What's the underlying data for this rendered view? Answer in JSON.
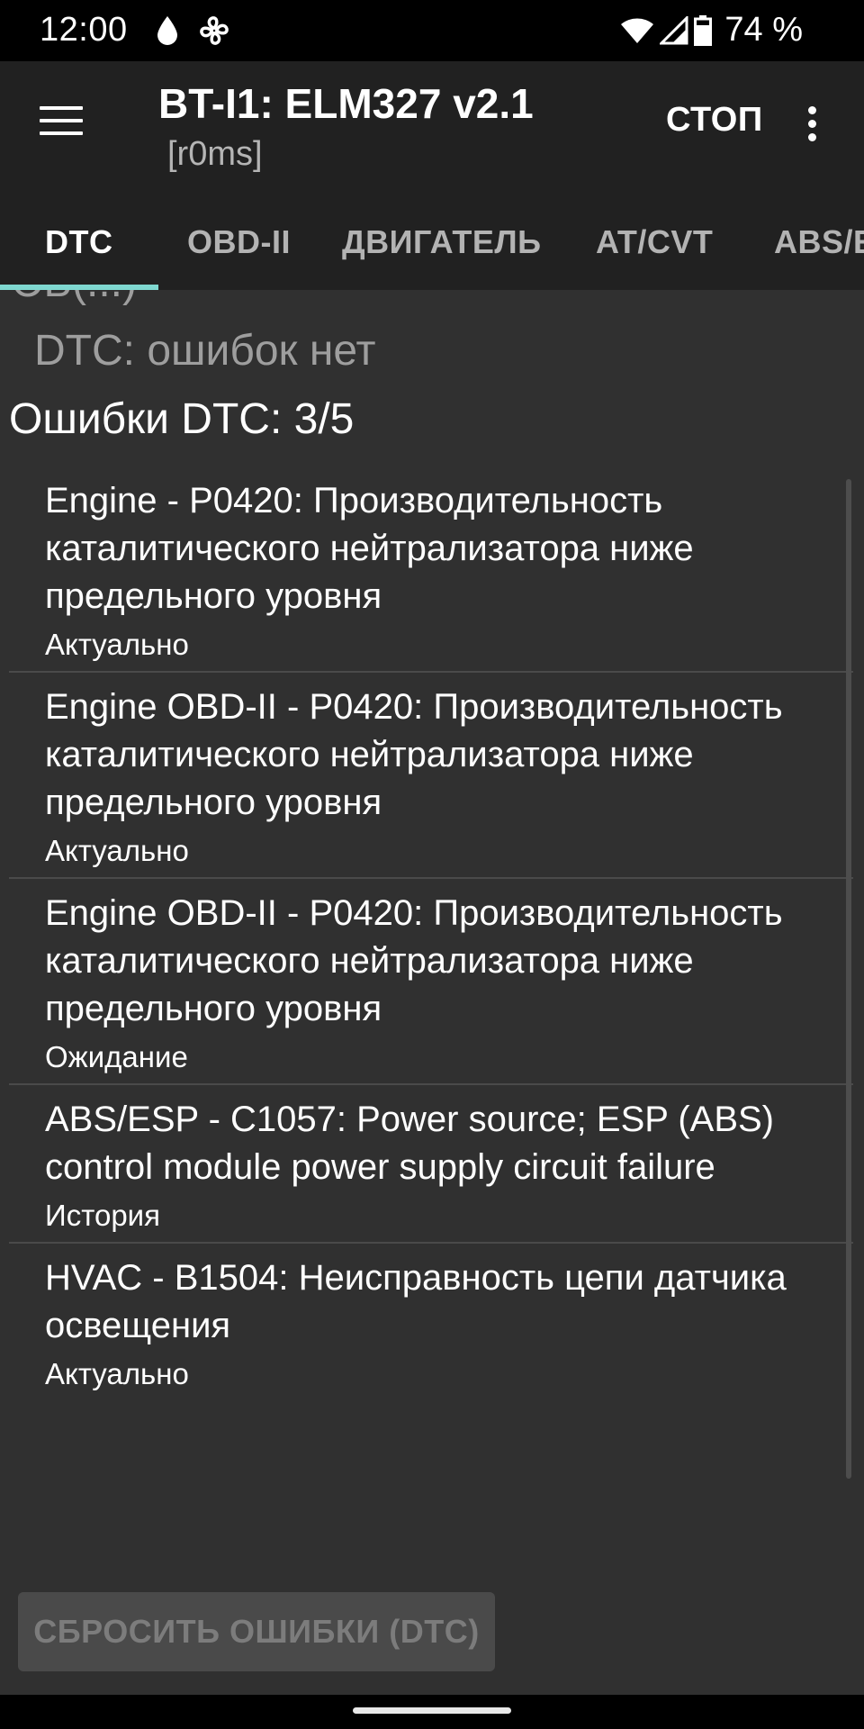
{
  "status_bar": {
    "time": "12:00",
    "battery": "74 %",
    "icons": [
      "water-drop-icon",
      "fan-icon",
      "wifi-icon",
      "cell-signal-icon",
      "battery-icon"
    ]
  },
  "app_bar": {
    "title": "BT-I1: ELM327 v2.1",
    "subtitle": "[r0ms]",
    "stop_label": "СТОП"
  },
  "tabs": [
    {
      "label": "DTC",
      "active": true
    },
    {
      "label": "OBD-II",
      "active": false
    },
    {
      "label": "ДВИГАТЕЛЬ",
      "active": false
    },
    {
      "label": "AT/CVT",
      "active": false
    },
    {
      "label": "ABS/E",
      "active": false
    }
  ],
  "content": {
    "partial_text": "ЭБ(...)",
    "dtc_status": "DTC: ошибок нет",
    "errors_title": "Ошибки DTC: 3/5",
    "items": [
      {
        "description": "Engine - P0420: Производительность каталитического нейтрализатора ниже предельного уровня",
        "state": "Актуально"
      },
      {
        "description": "Engine OBD-II - P0420: Производительность каталитического нейтрализатора ниже предельного уровня",
        "state": "Актуально"
      },
      {
        "description": "Engine OBD-II - P0420: Производительность каталитического нейтрализатора ниже предельного уровня",
        "state": "Ожидание"
      },
      {
        "description": "ABS/ESP - C1057: Power source; ESP (ABS) control module power supply circuit failure",
        "state": "История"
      },
      {
        "description": "HVAC - B1504: Неисправность цепи датчика освещения",
        "state": "Актуально"
      }
    ],
    "reset_button_label": "СБРОСИТЬ ОШИБКИ (DTC)"
  },
  "colors": {
    "tab_indicator": "#7fd8d0",
    "app_bar_bg": "#212121",
    "content_bg": "#303030"
  }
}
